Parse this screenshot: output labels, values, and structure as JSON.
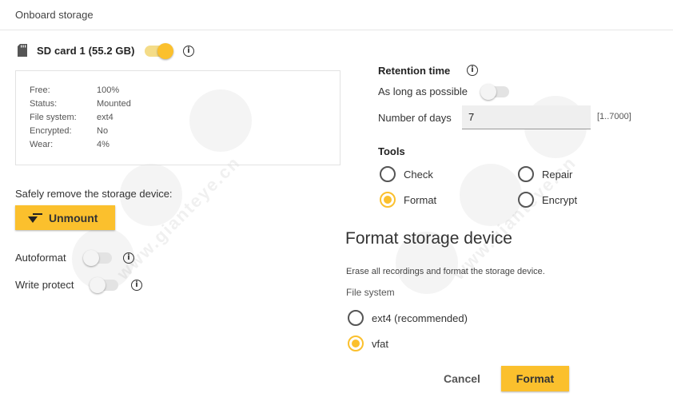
{
  "header": {
    "title": "Onboard storage"
  },
  "sd_card": {
    "label": "SD card 1 (55.2 GB)",
    "enabled": true,
    "icon": "sd-card-icon"
  },
  "status": {
    "rows": [
      {
        "key": "Free:",
        "value": "100%"
      },
      {
        "key": "Status:",
        "value": "Mounted"
      },
      {
        "key": "File system:",
        "value": "ext4"
      },
      {
        "key": "Encrypted:",
        "value": "No"
      },
      {
        "key": "Wear:",
        "value": "4%"
      }
    ]
  },
  "safely_remove": {
    "label": "Safely remove the storage device:",
    "button_label": "Unmount"
  },
  "autoformat": {
    "label": "Autoformat",
    "enabled": false
  },
  "write_protect": {
    "label": "Write protect",
    "enabled": false
  },
  "retention": {
    "title": "Retention time",
    "as_long_as_possible_label": "As long as possible",
    "as_long_as_possible": false,
    "days_label": "Number of days",
    "days_value": "7",
    "days_range": "[1..7000]"
  },
  "tools": {
    "title": "Tools",
    "options": [
      {
        "label": "Check",
        "selected": false
      },
      {
        "label": "Repair",
        "selected": false
      },
      {
        "label": "Format",
        "selected": true
      },
      {
        "label": "Encrypt",
        "selected": false
      }
    ]
  },
  "format_panel": {
    "title": "Format storage device",
    "description": "Erase all recordings and format the storage device.",
    "file_system_label": "File system",
    "options": [
      {
        "label": "ext4 (recommended)",
        "selected": false
      },
      {
        "label": "vfat",
        "selected": true
      }
    ],
    "cancel_label": "Cancel",
    "format_label": "Format"
  },
  "watermark": {
    "text": "www.gianteye.cn",
    "badge": "GIANTEYE"
  },
  "colors": {
    "accent": "#fbc02d",
    "text": "#333333",
    "border": "#e2e2e2"
  }
}
